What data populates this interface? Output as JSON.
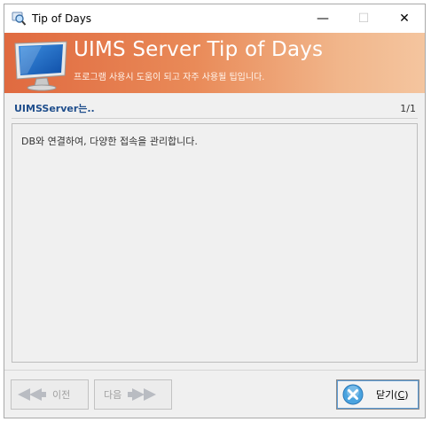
{
  "window": {
    "title": "Tip of Days",
    "controls": {
      "minimize": "—",
      "maximize": "☐",
      "close": "✕"
    }
  },
  "banner": {
    "title": "UIMS Server Tip of Days",
    "subtitle": "프로그램 사용시 도움이 되고 자주 사용될 팁입니다."
  },
  "tip": {
    "header": "UIMSServer는..",
    "counter": "1/1",
    "text": "DB와 연결하여, 다양한 접속을 관리합니다."
  },
  "buttons": {
    "prev_label": "이전",
    "next_label": "다음",
    "close_label_prefix": "닫기(",
    "close_hotkey": "C",
    "close_label_suffix": ")"
  }
}
